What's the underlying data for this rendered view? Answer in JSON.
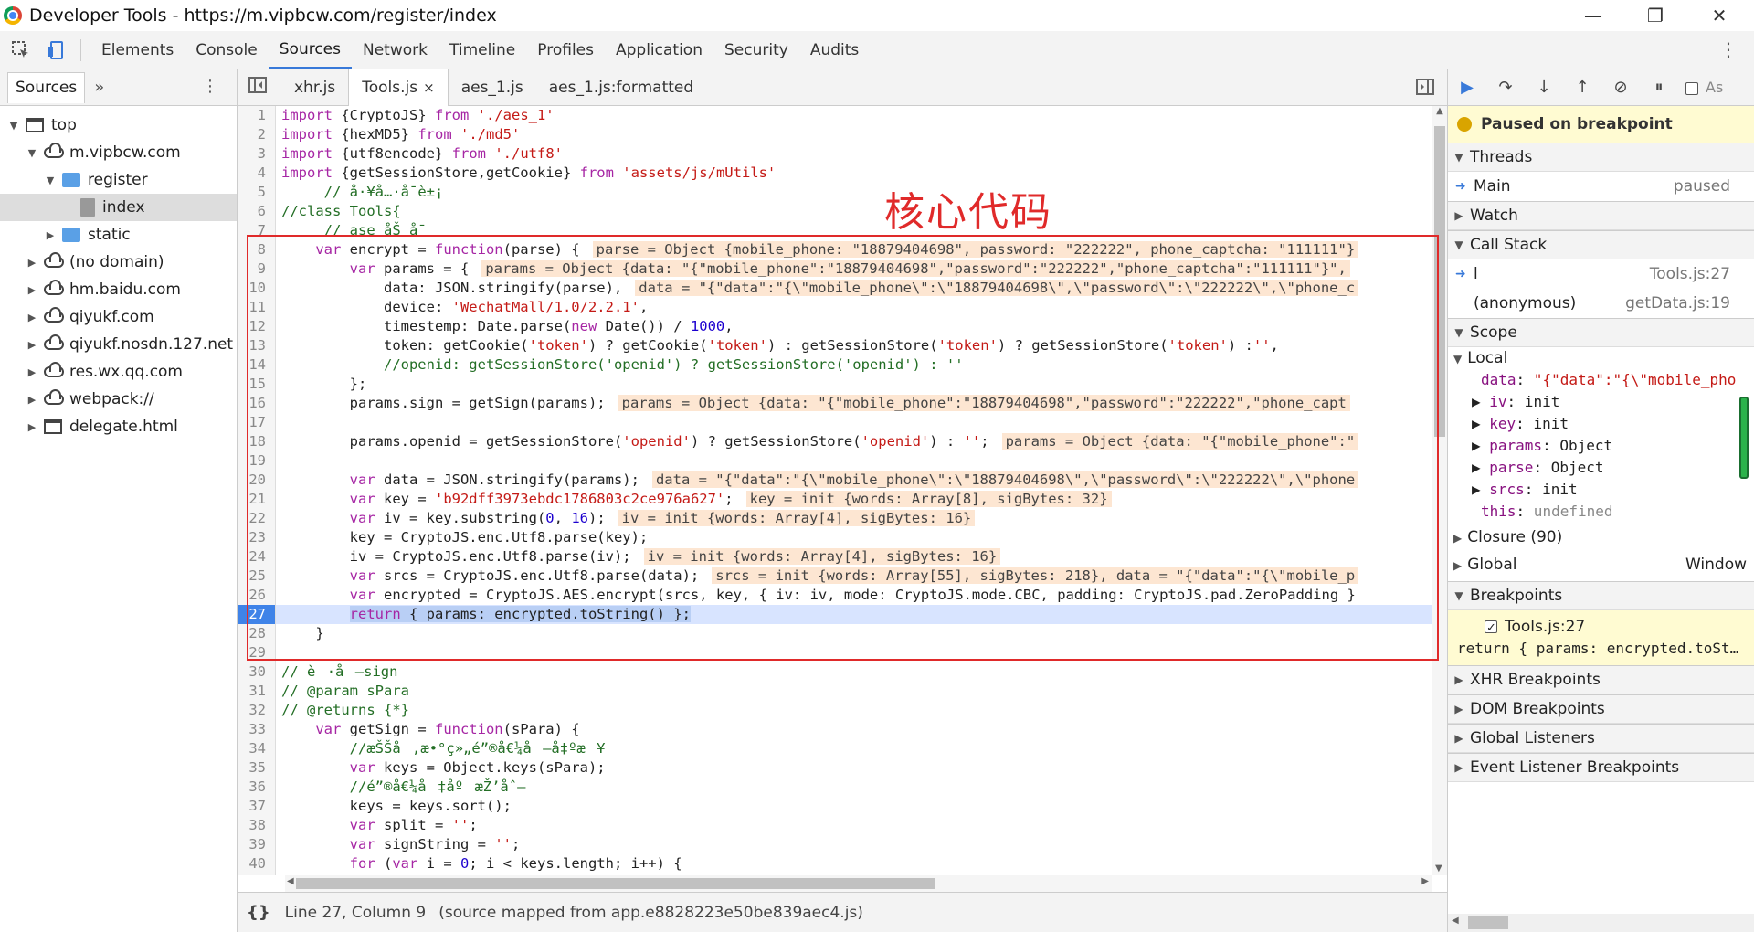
{
  "window": {
    "title": "Developer Tools - https://m.vipbcw.com/register/index",
    "minimize": "—",
    "restore": "❐",
    "close": "✕"
  },
  "main_tabs": [
    "Elements",
    "Console",
    "Sources",
    "Network",
    "Timeline",
    "Profiles",
    "Application",
    "Security",
    "Audits"
  ],
  "active_tab": "Sources",
  "navigator": {
    "tab": "Sources",
    "more": "»",
    "tree": [
      {
        "label": "top",
        "depth": 0,
        "icon": "frame",
        "arrow": "▼"
      },
      {
        "label": "m.vipbcw.com",
        "depth": 1,
        "icon": "cloud",
        "arrow": "▼"
      },
      {
        "label": "register",
        "depth": 2,
        "icon": "folder",
        "arrow": "▼"
      },
      {
        "label": "index",
        "depth": 3,
        "icon": "file",
        "arrow": "",
        "selected": true
      },
      {
        "label": "static",
        "depth": 2,
        "icon": "folder",
        "arrow": "▶"
      },
      {
        "label": "(no domain)",
        "depth": 1,
        "icon": "cloud",
        "arrow": "▶"
      },
      {
        "label": "hm.baidu.com",
        "depth": 1,
        "icon": "cloud",
        "arrow": "▶"
      },
      {
        "label": "qiyukf.com",
        "depth": 1,
        "icon": "cloud",
        "arrow": "▶"
      },
      {
        "label": "qiyukf.nosdn.127.net",
        "depth": 1,
        "icon": "cloud",
        "arrow": "▶"
      },
      {
        "label": "res.wx.qq.com",
        "depth": 1,
        "icon": "cloud",
        "arrow": "▶"
      },
      {
        "label": "webpack://",
        "depth": 1,
        "icon": "cloud",
        "arrow": "▶"
      },
      {
        "label": "delegate.html",
        "depth": 1,
        "icon": "frame",
        "arrow": "▶"
      }
    ]
  },
  "file_tabs": [
    {
      "label": "xhr.js"
    },
    {
      "label": "Tools.js",
      "active": true,
      "close": "×"
    },
    {
      "label": "aes_1.js"
    },
    {
      "label": "aes_1.js:formatted"
    }
  ],
  "annotation": "核心代码",
  "code": [
    {
      "n": 1,
      "h": "<span class='k'>import</span> {CryptoJS} <span class='k'>from</span> <span class='s'>'./aes_1'</span>"
    },
    {
      "n": 2,
      "h": "<span class='k'>import</span> {hexMD5} <span class='k'>from</span> <span class='s'>'./md5'</span>"
    },
    {
      "n": 3,
      "h": "<span class='k'>import</span> {utf8encode} <span class='k'>from</span> <span class='s'>'./utf8'</span>"
    },
    {
      "n": 4,
      "h": "<span class='k'>import</span> {getSessionStore,getCookie} <span class='k'>from</span> <span class='s'>'assets/js/mUtils'</span>"
    },
    {
      "n": 5,
      "h": "     <span class='c'>// å·¥å…·å¯è±¡</span>"
    },
    {
      "n": 6,
      "h": "<span class='c'>//class Tools{</span>"
    },
    {
      "n": 7,
      "h": "     <span class='c'>// ase åŠ å¯</span>"
    },
    {
      "n": 8,
      "h": "    <span class='k'>var</span> encrypt = <span class='k'>function</span>(parse) {<span class='val'>parse = Object {mobile_phone: \"18879404698\", password: \"222222\", phone_captcha: \"111111\"}</span>"
    },
    {
      "n": 9,
      "h": "        <span class='k'>var</span> params = {<span class='val'>params = Object {data: \"{\"mobile_phone\":\"18879404698\",\"password\":\"222222\",\"phone_captcha\":\"111111\"}\",</span>"
    },
    {
      "n": 10,
      "h": "            data: JSON.stringify(parse),<span class='val'>data = \"{\"data\":\"{\\\"mobile_phone\\\":\\\"18879404698\\\",\\\"password\\\":\\\"222222\\\",\\\"phone_c</span>"
    },
    {
      "n": 11,
      "h": "            device: <span class='s'>'WechatMall/1.0/2.2.1'</span>,"
    },
    {
      "n": 12,
      "h": "            timestemp: Date.parse(<span class='k'>new</span> Date()) / <span class='n'>1000</span>,"
    },
    {
      "n": 13,
      "h": "            token: getCookie(<span class='s'>'token'</span>) ? getCookie(<span class='s'>'token'</span>) : getSessionStore(<span class='s'>'token'</span>) ? getSessionStore(<span class='s'>'token'</span>) :<span class='s'>''</span>,"
    },
    {
      "n": 14,
      "h": "            <span class='c'>//openid: getSessionStore('openid') ? getSessionStore('openid') : ''</span>"
    },
    {
      "n": 15,
      "h": "        };"
    },
    {
      "n": 16,
      "h": "        params.sign = getSign(params);<span class='val'>params = Object {data: \"{\"mobile_phone\":\"18879404698\",\"password\":\"222222\",\"phone_capt</span>"
    },
    {
      "n": 17,
      "h": ""
    },
    {
      "n": 18,
      "h": "        params.openid = getSessionStore(<span class='s'>'openid'</span>) ? getSessionStore(<span class='s'>'openid'</span>) : <span class='s'>''</span>;<span class='val'>params = Object {data: \"{\"mobile_phone\":\"</span>"
    },
    {
      "n": 19,
      "h": ""
    },
    {
      "n": 20,
      "h": "        <span class='k'>var</span> data = JSON.stringify(params);<span class='val'>data = \"{\"data\":\"{\\\"mobile_phone\\\":\\\"18879404698\\\",\\\"password\\\":\\\"222222\\\",\\\"phone</span>"
    },
    {
      "n": 21,
      "h": "        <span class='k'>var</span> key = <span class='s'>'b92dff3973ebdc1786803c2ce976a627'</span>;<span class='val'>key = init {words: Array[8], sigBytes: 32}</span>"
    },
    {
      "n": 22,
      "h": "        <span class='k'>var</span> iv = key.substring(<span class='n'>0</span>, <span class='n'>16</span>);<span class='val'>iv = init {words: Array[4], sigBytes: 16}</span>"
    },
    {
      "n": 23,
      "h": "        key = CryptoJS.enc.Utf8.parse(key);"
    },
    {
      "n": 24,
      "h": "        iv = CryptoJS.enc.Utf8.parse(iv);<span class='val'>iv = init {words: Array[4], sigBytes: 16}</span>"
    },
    {
      "n": 25,
      "h": "        <span class='k'>var</span> srcs = CryptoJS.enc.Utf8.parse(data);<span class='val'>srcs = init {words: Array[55], sigBytes: 218}, data = \"{\"data\":\"{\\\"mobile_p</span>"
    },
    {
      "n": 26,
      "h": "        <span class='k'>var</span> encrypted = CryptoJS.AES.encrypt(srcs, key, { iv: iv, mode: CryptoJS.mode.CBC, padding: CryptoJS.pad.ZeroPadding }"
    },
    {
      "n": 27,
      "h": "        <span class='hl'><span class='k'>return</span> { params: encrypted.toString() };</span>",
      "bp": true
    },
    {
      "n": 28,
      "h": "    }"
    },
    {
      "n": 29,
      "h": ""
    },
    {
      "n": 30,
      "h": "<span class='c'>// è·å–sign</span>"
    },
    {
      "n": 31,
      "h": "<span class='c'>// @param sPara</span>"
    },
    {
      "n": 32,
      "h": "<span class='c'>// @returns {*}</span>"
    },
    {
      "n": 33,
      "h": "    <span class='k'>var</span> getSign = <span class='k'>function</span>(sPara) {"
    },
    {
      "n": 34,
      "h": "        <span class='c'>//æŠŠå‚æ•°ç»„é”®å€¼å–å‡ºæ¥</span>"
    },
    {
      "n": 35,
      "h": "        <span class='k'>var</span> keys = Object.keys(sPara);"
    },
    {
      "n": 36,
      "h": "        <span class='c'>//é”®å€¼å‡åºæŽ’åˆ—</span>"
    },
    {
      "n": 37,
      "h": "        keys = keys.sort();"
    },
    {
      "n": 38,
      "h": "        <span class='k'>var</span> split = <span class='s'>''</span>;"
    },
    {
      "n": 39,
      "h": "        <span class='k'>var</span> signString = <span class='s'>''</span>;"
    },
    {
      "n": 40,
      "h": "        <span class='k'>for</span> (<span class='k'>var</span> i = <span class='n'>0</span>; i &lt; keys.length; i++) {"
    },
    {
      "n": 41,
      "h": ""
    }
  ],
  "status": {
    "braces": "{}",
    "position": "Line 27, Column 9",
    "mapped": "(source mapped from app.e8828223e50be839aec4.js)"
  },
  "debugger": {
    "toolbar": {
      "resume": "▶",
      "step_over": "↷",
      "step_into": "↓",
      "step_out": "↑",
      "deactivate": "⊘",
      "pause_exc": "⏸",
      "async_label": "As"
    },
    "paused": "Paused on breakpoint",
    "threads": {
      "title": "Threads",
      "main": "Main",
      "state": "paused"
    },
    "watch": "Watch",
    "callstack": {
      "title": "Call Stack",
      "frames": [
        {
          "name": "l",
          "loc": "Tools.js:27",
          "current": true
        },
        {
          "name": "(anonymous)",
          "loc": "getData.js:19"
        }
      ]
    },
    "scope": {
      "title": "Scope",
      "local": "Local",
      "vars": [
        {
          "arrow": "",
          "key": "data",
          "val": " \"{\"data\":\"{\\\"mobile_pho",
          "str": true
        },
        {
          "arrow": "▶",
          "key": "iv",
          "val": " init"
        },
        {
          "arrow": "▶",
          "key": "key",
          "val": " init"
        },
        {
          "arrow": "▶",
          "key": "params",
          "val": " Object"
        },
        {
          "arrow": "▶",
          "key": "parse",
          "val": " Object"
        },
        {
          "arrow": "▶",
          "key": "srcs",
          "val": " init"
        },
        {
          "arrow": "",
          "key": "this",
          "val": " undefined",
          "gray": true
        }
      ],
      "closure": "Closure (90)",
      "global": "Global",
      "global_val": "Window"
    },
    "breakpoints": {
      "title": "Breakpoints",
      "file": "Tools.js:27",
      "code": "return { params: encrypted.toSt…"
    },
    "sections": [
      "XHR Breakpoints",
      "DOM Breakpoints",
      "Global Listeners",
      "Event Listener Breakpoints"
    ]
  }
}
